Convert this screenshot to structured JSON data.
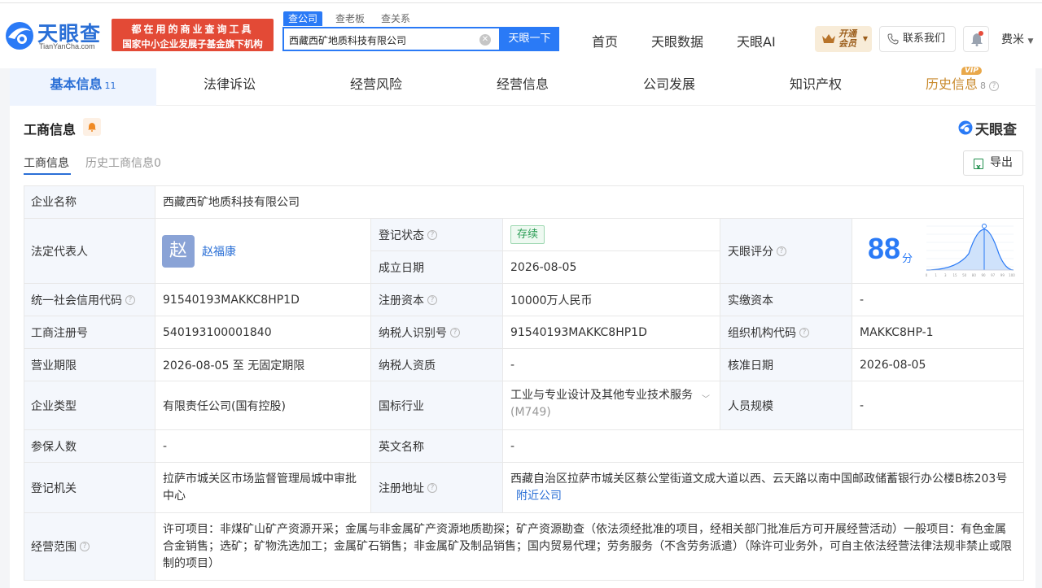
{
  "header": {
    "logo_cn": "天眼查",
    "logo_en": "TianYanCha.com",
    "promo_line1": "都在用的商业查询工具",
    "promo_line2": "国家中小企业发展子基金旗下机构",
    "search_tabs": [
      "查公司",
      "查老板",
      "查关系"
    ],
    "search_value": "西藏西矿地质科技有限公司",
    "search_button": "天眼一下",
    "nav": [
      "首页",
      "天眼数据",
      "天眼AI"
    ],
    "vip_line1": "开通",
    "vip_line2": "会员",
    "contact": "联系我们",
    "user": "费米"
  },
  "tabs": [
    {
      "label": "基本信息",
      "count": "11"
    },
    {
      "label": "法律诉讼"
    },
    {
      "label": "经营风险"
    },
    {
      "label": "经营信息"
    },
    {
      "label": "公司发展"
    },
    {
      "label": "知识产权"
    },
    {
      "label": "历史信息",
      "count": "8",
      "badge": "VIP"
    }
  ],
  "section": {
    "title": "工商信息",
    "brand": "天眼查",
    "subtabs": [
      "工商信息",
      "历史工商信息0"
    ],
    "export": "导出"
  },
  "info": {
    "company_name_label": "企业名称",
    "company_name": "西藏西矿地质科技有限公司",
    "legal_rep_label": "法定代表人",
    "legal_rep_avatar": "赵",
    "legal_rep": "赵福康",
    "reg_status_label": "登记状态",
    "reg_status": "存续",
    "founded_label": "成立日期",
    "founded": "2026-08-05",
    "score_label": "天眼评分",
    "score": "88",
    "score_unit": "分",
    "credit_code_label": "统一社会信用代码",
    "credit_code": "91540193MAKKC8HP1D",
    "reg_capital_label": "注册资本",
    "reg_capital": "10000万人民币",
    "paid_capital_label": "实缴资本",
    "paid_capital": "-",
    "biz_reg_no_label": "工商注册号",
    "biz_reg_no": "540193100001840",
    "taxpayer_id_label": "纳税人识别号",
    "taxpayer_id": "91540193MAKKC8HP1D",
    "org_code_label": "组织机构代码",
    "org_code": "MAKKC8HP-1",
    "term_label": "营业期限",
    "term": "2026-08-05 至 无固定期限",
    "taxpayer_qual_label": "纳税人资质",
    "taxpayer_qual": "-",
    "approve_date_label": "核准日期",
    "approve_date": "2026-08-05",
    "type_label": "企业类型",
    "type": "有限责任公司(国有控股)",
    "industry_label": "国标行业",
    "industry": "工业与专业设计及其他专业技术服务",
    "industry_code": "(M749)",
    "staff_label": "人员规模",
    "staff": "-",
    "insured_label": "参保人数",
    "insured": "-",
    "english_name_label": "英文名称",
    "english_name": "-",
    "authority_label": "登记机关",
    "authority": "拉萨市城关区市场监督管理局城中审批中心",
    "address_label": "注册地址",
    "address": "西藏自治区拉萨市城关区蔡公堂街道文成大道以西、云天路以南中国邮政储蓄银行办公楼B栋203号",
    "nearby": "附近公司",
    "scope_label": "经营范围",
    "scope": "许可项目：非煤矿山矿产资源开采；金属与非金属矿产资源地质勘探；矿产资源勘查（依法须经批准的项目，经相关部门批准后方可开展经营活动）一般项目：有色金属合金销售；选矿；矿物洗选加工；金属矿石销售；非金属矿及制品销售；国内贸易代理；劳务服务（不含劳务派遣）（除许可业务外，可自主依法经营法律法规非禁止或限制的项目）"
  },
  "score_chart_ticks": [
    "0",
    "1",
    "3",
    "15",
    "50",
    "80",
    "90",
    "97",
    "99",
    "100"
  ],
  "colors": {
    "accent": "#2a7af6",
    "promo": "#e34a36",
    "status_green": "#2b9d55",
    "label_bg": "#f4f7fc"
  }
}
